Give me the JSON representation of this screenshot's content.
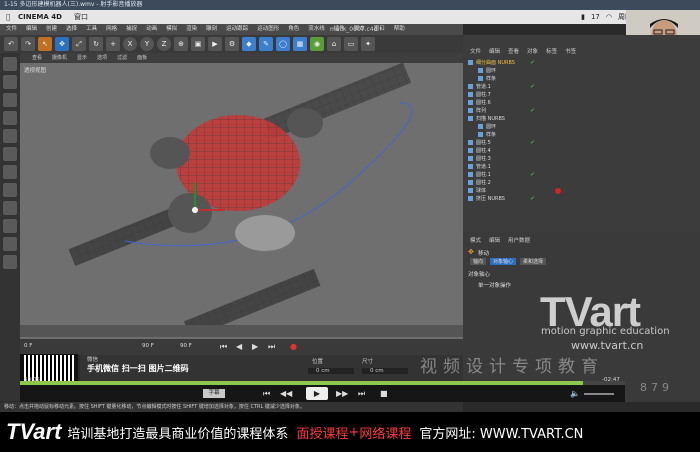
{
  "window_title": "1-15 多边形建模机器人(三).wmv - 射手影音播放器",
  "mac_menu": {
    "app": "CINEMA 4D",
    "window": "窗口"
  },
  "mac_status": {
    "battery_value": "17",
    "time": "周四"
  },
  "c4d_menu": [
    "文件",
    "编辑",
    "创建",
    "选择",
    "工具",
    "网格",
    "捕捉",
    "动画",
    "模拟",
    "渲染",
    "雕刻",
    "运动跟踪",
    "运动图形",
    "角色",
    "流水线",
    "插件",
    "脚本",
    "窗口",
    "帮助"
  ],
  "doc_title": "meck_0007.c4d *",
  "viewport": {
    "menu": [
      "查看",
      "摄像机",
      "显示",
      "选项",
      "过滤",
      "面板"
    ],
    "label": "透视视图"
  },
  "object_panel": {
    "tabs": [
      "文件",
      "编辑",
      "查看",
      "对象",
      "标签",
      "书签"
    ],
    "rows": [
      "细分曲面 NURBS",
      "圆环",
      "样条",
      "管道.1",
      "圆柱.7",
      "圆柱.6",
      "阵列",
      "扫描 NURBS",
      "圆环",
      "样条",
      "圆柱.5",
      "圆柱.4",
      "圆柱.3",
      "管道.1",
      "圆柱.1",
      "圆柱.2",
      "球体",
      "挤压 NURBS"
    ]
  },
  "attr_panel": {
    "tabs": [
      "模式",
      "编辑",
      "用户数据"
    ],
    "tool": "移动",
    "subtabs": [
      "轴向",
      "对象轴心",
      "柔和选择"
    ],
    "section": "对象轴心",
    "option": "单一对象操作"
  },
  "coord": {
    "pos_label": "位置",
    "size_label": "尺寸",
    "pos_x": "0 cm",
    "size_x": "0 cm"
  },
  "timeline": {
    "start": "0 F",
    "end": "90 F",
    "fps": "90 F"
  },
  "watermark": {
    "logo": "TVart",
    "sub": "motion graphic education",
    "url": "www.tvart.cn",
    "cn": "视频设计专项教育",
    "num": "879"
  },
  "qr": {
    "title": "微信",
    "text": "手机微信  扫一扫  图片二维码"
  },
  "player": {
    "time_left": "50:05",
    "time_right": "-02:47",
    "progress": 0.93,
    "sub_label": "字幕"
  },
  "status_text": "移动：点击并拖动鼠标移动元素。按住 SHIFT 键量化移动，节点编辑模式时按住 SHIFT 键增加选择对象，按住 CTRL 键减少选择对象。",
  "footer": {
    "logo": "TVart",
    "tag": "培训基地打造最具商业价值的课程体系",
    "red1": "面授课程",
    "plus": "+",
    "red2": "网络课程",
    "site": "官方网址: WWW.TVART.CN"
  }
}
